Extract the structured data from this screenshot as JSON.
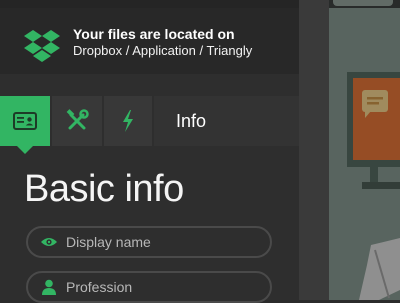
{
  "notice": {
    "line1": "Your files are located on",
    "line2": "Dropbox / Application / Triangly",
    "icon": "dropbox-icon"
  },
  "tabs": [
    {
      "icon": "id-card-icon",
      "active": true
    },
    {
      "icon": "tools-icon",
      "active": false
    },
    {
      "icon": "lightning-icon",
      "active": false
    },
    {
      "label": "Info"
    }
  ],
  "form": {
    "title": "Basic info",
    "fields": [
      {
        "icon": "eye-icon",
        "placeholder": "Display name",
        "value": ""
      },
      {
        "icon": "user-icon",
        "placeholder": "Profession",
        "value": ""
      }
    ]
  },
  "colors": {
    "accent": "#32b563",
    "panel": "#2e2e2e",
    "text": "#ffffff"
  }
}
